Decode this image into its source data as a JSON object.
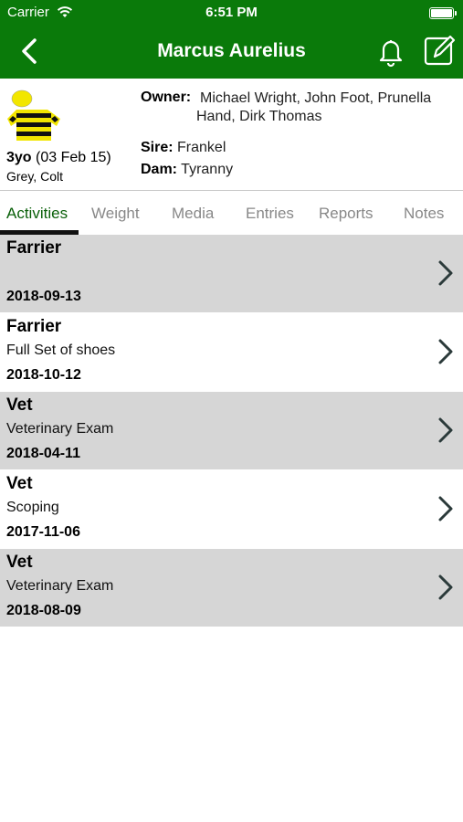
{
  "status_bar": {
    "carrier": "Carrier",
    "time": "6:51 PM"
  },
  "header": {
    "title": "Marcus Aurelius"
  },
  "horse": {
    "age": "3yo",
    "dob": "(03 Feb 15)",
    "color_sex": "Grey, Colt",
    "owner_label": "Owner:",
    "owner_line1": "Michael Wright, John Foot, Prunella",
    "owner_line2": "Hand, Dirk Thomas",
    "sire_label": "Sire:",
    "sire": "Frankel",
    "dam_label": "Dam:",
    "dam": "Tyranny"
  },
  "tabs": [
    {
      "label": "Activities",
      "active": true
    },
    {
      "label": "Weight"
    },
    {
      "label": "Media"
    },
    {
      "label": "Entries"
    },
    {
      "label": "Reports"
    },
    {
      "label": "Notes"
    }
  ],
  "activities": [
    {
      "title": "Farrier",
      "description": "",
      "date": "2018-09-13"
    },
    {
      "title": "Farrier",
      "description": "Full Set of shoes",
      "date": "2018-10-12"
    },
    {
      "title": "Vet",
      "description": "Veterinary Exam",
      "date": "2018-04-11"
    },
    {
      "title": "Vet",
      "description": "Scoping",
      "date": "2017-11-06"
    },
    {
      "title": "Vet",
      "description": "Veterinary Exam",
      "date": "2018-08-09"
    }
  ],
  "colors": {
    "header_green": "#0a7a0a",
    "active_tab": "#0a600a",
    "row_gray": "#d6d6d6",
    "silk_yellow": "#f2e600"
  },
  "icons": [
    "back-chevron-icon",
    "bell-icon",
    "edit-icon",
    "wifi-icon",
    "battery-icon",
    "chevron-right-icon"
  ]
}
